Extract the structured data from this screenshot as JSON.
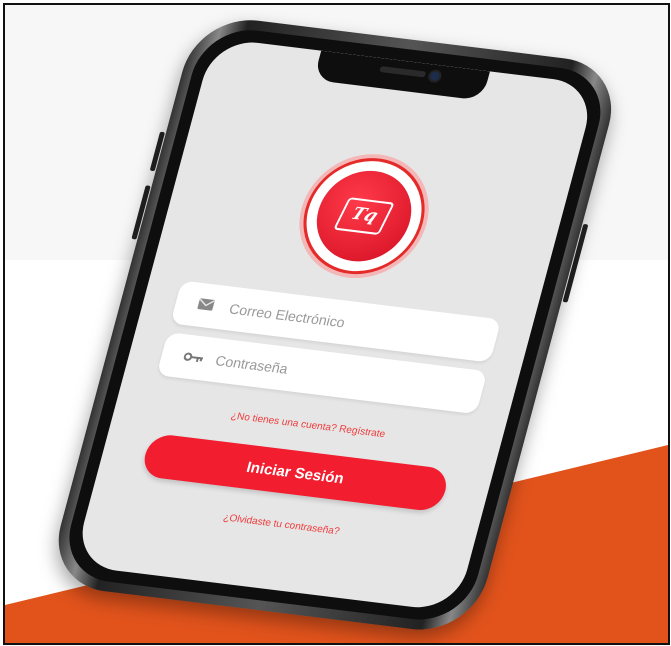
{
  "colors": {
    "accent": "#f21d2f",
    "link": "#ef3b3b",
    "screen_bg": "#e6e6e6",
    "orange": "#e2531c"
  },
  "logo": {
    "text": "Tq",
    "icon": "logo-icon"
  },
  "form": {
    "email_placeholder": "Correo Electrónico",
    "email_icon": "mail-icon",
    "password_placeholder": "Contraseña",
    "password_icon": "key-icon"
  },
  "links": {
    "register": "¿No tienes una cuenta? Regístrate",
    "forgot": "¿Olvidaste tu contraseña?"
  },
  "buttons": {
    "login": "Iniciar Sesión"
  }
}
